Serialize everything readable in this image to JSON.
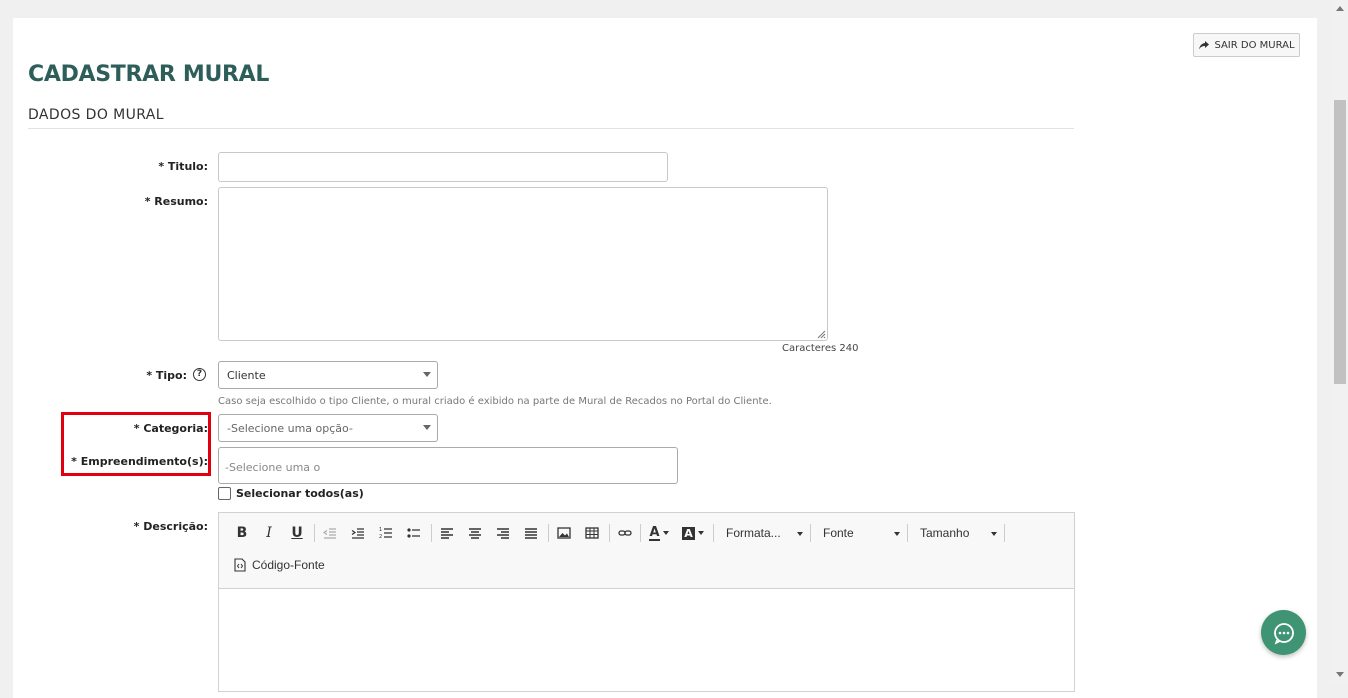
{
  "header": {
    "exit_button": "SAIR DO MURAL",
    "page_title": "CADASTRAR MURAL",
    "section_title": "DADOS DO MURAL"
  },
  "form": {
    "titulo": {
      "label": "* Titulo:",
      "value": ""
    },
    "resumo": {
      "label": "* Resumo:",
      "value": "",
      "counter": "Caracteres 240"
    },
    "tipo": {
      "label": "* Tipo:",
      "help_icon": "?",
      "selected": "Cliente",
      "hint": "Caso seja escolhido o tipo Cliente, o mural criado é exibido na parte de Mural de Recados no Portal do Cliente."
    },
    "categoria": {
      "label": "* Categoria:",
      "selected": "-Selecione uma opção-"
    },
    "empreendimentos": {
      "label": "* Empreendimento(s):",
      "placeholder": "-Selecione uma opç"
    },
    "selecionar_todos": {
      "label": "Selecionar todos(as)",
      "checked": false
    },
    "descricao": {
      "label": "* Descrição:"
    }
  },
  "editor": {
    "bold": "B",
    "italic": "I",
    "underline": "U",
    "format_label": "Formata...",
    "font_label": "Fonte",
    "size_label": "Tamanho",
    "source_label": "Código-Fonte",
    "font_color_letter": "A",
    "bg_color_letter": "A"
  },
  "colors": {
    "title": "#2e5e5a",
    "highlight": "#e0000f",
    "chat_fab": "#3f9474"
  }
}
